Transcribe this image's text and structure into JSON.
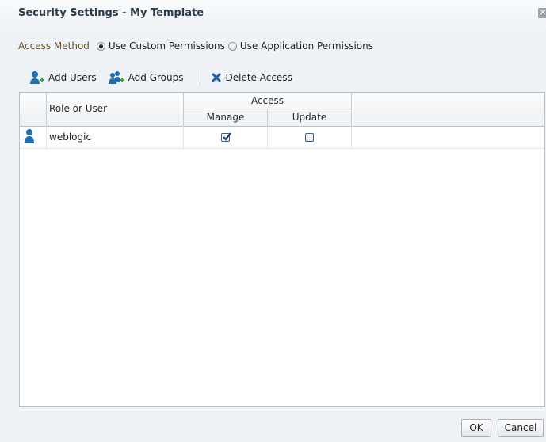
{
  "dialog": {
    "title": "Security Settings - My Template"
  },
  "access_method": {
    "label": "Access Method",
    "options": [
      {
        "label": "Use Custom Permissions",
        "selected": true
      },
      {
        "label": "Use Application Permissions",
        "selected": false
      }
    ]
  },
  "toolbar": {
    "add_users": "Add Users",
    "add_groups": "Add Groups",
    "delete_access": "Delete Access"
  },
  "table": {
    "columns": {
      "role_or_user": "Role or User",
      "access": "Access",
      "manage": "Manage",
      "update": "Update"
    },
    "rows": [
      {
        "name": "weblogic",
        "manage": true,
        "update": false
      }
    ]
  },
  "buttons": {
    "ok": "OK",
    "cancel": "Cancel"
  },
  "colors": {
    "title": "#2b3a4a",
    "access_label": "#6a4f22",
    "icon_blue": "#1f6fb5",
    "delete_blue": "#1f5fa8"
  }
}
